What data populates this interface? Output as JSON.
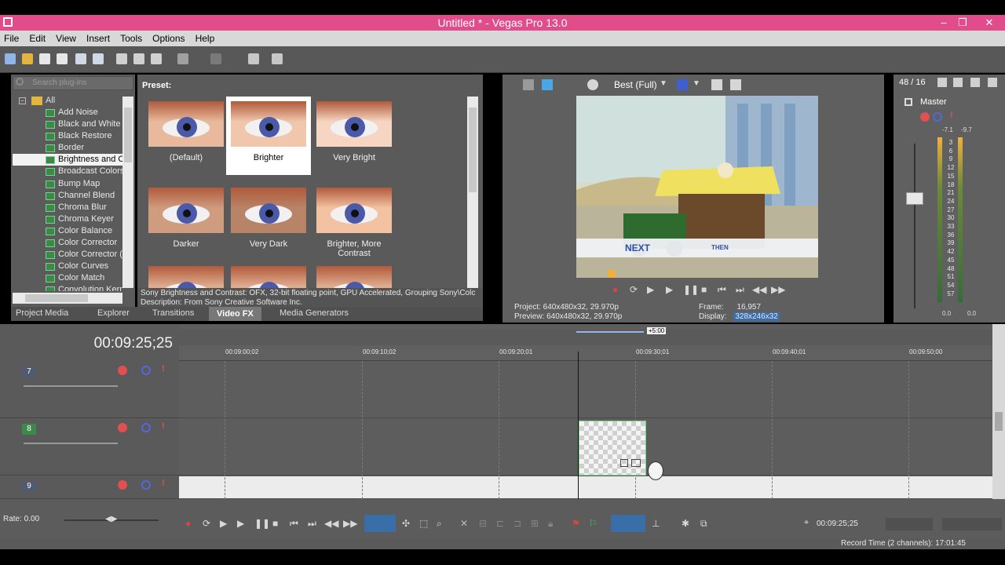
{
  "window": {
    "title": "Untitled * - Vegas Pro 13.0",
    "minimize": "–",
    "restore": "❐",
    "close": "✕"
  },
  "menu": [
    "File",
    "Edit",
    "View",
    "Insert",
    "Tools",
    "Options",
    "Help"
  ],
  "plugins": {
    "search_placeholder": "Search plug-ins",
    "root": "All",
    "items": [
      "Add Noise",
      "Black and White",
      "Black Restore",
      "Border",
      "Brightness and Co",
      "Broadcast Colors",
      "Bump Map",
      "Channel Blend",
      "Chroma Blur",
      "Chroma Keyer",
      "Color Balance",
      "Color Corrector",
      "Color Corrector (S",
      "Color Curves",
      "Color Match",
      "Convolution Kerne"
    ],
    "selected_index": 4
  },
  "presets": {
    "label": "Preset:",
    "items": [
      "(Default)",
      "Brighter",
      "Very Bright",
      "Darker",
      "Very Dark",
      "Brighter, More Contrast"
    ],
    "selected_index": 1,
    "description_line1": "Sony Brightness and Contrast: OFX, 32-bit floating point, GPU Accelerated, Grouping Sony\\Colc",
    "description_line2": "Description: From Sony Creative Software Inc."
  },
  "tabs": [
    "Project Media",
    "Explorer",
    "Transitions",
    "Video FX",
    "Media Generators"
  ],
  "active_tab": "Video FX",
  "preview": {
    "quality": "Best (Full)",
    "project_line": "Project:  640x480x32, 29.970p",
    "preview_line": "Preview:  640x480x32, 29.970p",
    "frame_label": "Frame:",
    "frame_value": "16,957",
    "display_label": "Display:",
    "display_value": "328x246x32",
    "scene_text_next": "NEXT",
    "scene_text_then": "THEN"
  },
  "master": {
    "ratio": "48 / 16",
    "label": "Master",
    "peak_left": "-7.1",
    "peak_right": "-9.7",
    "scale": [
      "3",
      "6",
      "9",
      "12",
      "15",
      "18",
      "21",
      "24",
      "27",
      "30",
      "33",
      "36",
      "39",
      "42",
      "45",
      "48",
      "51",
      "54",
      "57"
    ],
    "bottom_left": "0.0",
    "bottom_right": "0.0"
  },
  "timeline": {
    "timecode": "00:09:25;25",
    "offset_badge": "+5:00",
    "ruler": [
      "00:09:00;02",
      "00:09:10;02",
      "00:09:20;01",
      "00:09:30;01",
      "00:09:40;01",
      "00:09:50;00"
    ],
    "tracks": [
      "7",
      "8",
      "9"
    ]
  },
  "transport": {
    "rate": "Rate: 0.00",
    "timecode": "00:09:25;25",
    "record_time": "Record Time (2 channels): 17:01:45"
  },
  "colors": {
    "title_bar": "#e04d8a",
    "panel": "#5f5f5f",
    "clip_border": "#7bd08a"
  }
}
